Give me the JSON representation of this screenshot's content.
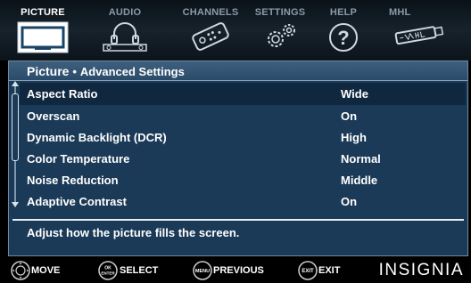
{
  "tabs": [
    {
      "label": "PICTURE",
      "icon": "tv-icon",
      "active": true
    },
    {
      "label": "AUDIO",
      "icon": "headphones-icon",
      "active": false
    },
    {
      "label": "CHANNELS",
      "icon": "remote-icon",
      "active": false
    },
    {
      "label": "SETTINGS",
      "icon": "gears-icon",
      "active": false
    },
    {
      "label": "HELP",
      "icon": "help-icon",
      "active": false
    },
    {
      "label": "MHL",
      "icon": "mhl-cable-icon",
      "active": false
    }
  ],
  "panel": {
    "title": "Picture",
    "separator": "•",
    "subtitle": "Advanced Settings"
  },
  "settings": [
    {
      "label": "Aspect Ratio",
      "value": "Wide",
      "selected": true
    },
    {
      "label": "Overscan",
      "value": "On",
      "selected": false
    },
    {
      "label": "Dynamic Backlight (DCR)",
      "value": "High",
      "selected": false
    },
    {
      "label": "Color Temperature",
      "value": "Normal",
      "selected": false
    },
    {
      "label": "Noise Reduction",
      "value": "Middle",
      "selected": false
    },
    {
      "label": "Adaptive Contrast",
      "value": "On",
      "selected": false
    }
  ],
  "help_text": "Adjust how the picture fills the screen.",
  "hints": [
    {
      "button": "",
      "label": "MOVE",
      "icon": "dpad-icon"
    },
    {
      "button": "OK\nENTER",
      "label": "SELECT"
    },
    {
      "button": "MENU",
      "label": "PREVIOUS"
    },
    {
      "button": "EXIT",
      "label": "EXIT"
    }
  ],
  "brand": "INSIGNIA",
  "colors": {
    "panel_bg": "#1b3a57",
    "selected_row": "#0f2840",
    "header_bg": "#2a4b69",
    "text": "#ffffff"
  }
}
